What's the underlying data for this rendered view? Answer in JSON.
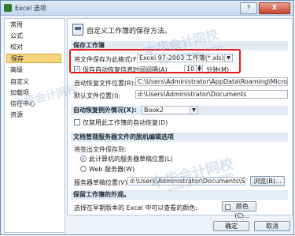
{
  "window": {
    "title": "Excel 选项",
    "help": "?",
    "close": "X"
  },
  "sidebar": {
    "items": [
      {
        "label": "常用"
      },
      {
        "label": "公式"
      },
      {
        "label": "校对"
      },
      {
        "label": "保存",
        "active": true
      },
      {
        "label": "高级"
      },
      {
        "label": "自定义"
      },
      {
        "label": "加载项"
      },
      {
        "label": "信任中心"
      },
      {
        "label": "资源"
      }
    ]
  },
  "main": {
    "header": "自定义工作簿的保存方法。",
    "save_section": "保存工作簿",
    "format_label": "将文件保存为此格式(F):",
    "format_value": "Excel 97-2003 工作簿(*.xls)",
    "autorecover_label": "保存自动恢复信息时间间隔(A)",
    "autorecover_checked": "✓",
    "autorecover_minutes": "10",
    "minutes_unit": "分钟(M)",
    "autorecover_location_label": "自动恢复文件位置(R):",
    "autorecover_location_value": "C:\\Users\\Administrator\\AppData\\Roaming\\Microsoft\\Exce",
    "default_location_label": "默认文件位置(I):",
    "default_location_value": "d:\\Users\\Administrator\\Documents",
    "exceptions_label": "自动恢复例外情况(X):",
    "exceptions_workbook": "Book2",
    "disable_recover_label": "仅禁用此工作簿的自动恢复(D)",
    "server_section": "文档管理服务器文件的脱机编辑选项",
    "checked_out_label": "将签出文件保存到:",
    "radio_local": "此计算机的服务器草稿位置(L)",
    "radio_web": "Web 服务器(W)",
    "drafts_label": "服务器草稿位置(V):",
    "drafts_value": "d:\\Users\\Administrator\\Documents\\SharePoin",
    "browse_button": "浏览(B)...",
    "visual_section": "保留工作簿的外观。",
    "colors_label": "选择在早期版本的 Excel 中可以查看的颜色:",
    "colors_button": "颜色(C)..."
  },
  "footer": {
    "ok": "确定",
    "cancel": "取消"
  },
  "watermarks": [
    "中华会计网校",
    "www.chinaacc.com",
    "中华会计网校",
    "www.chinaacc.com",
    "中华会计网校"
  ],
  "accent": {
    "highlight": "#e01919",
    "active_nav": "#f6d47a"
  }
}
